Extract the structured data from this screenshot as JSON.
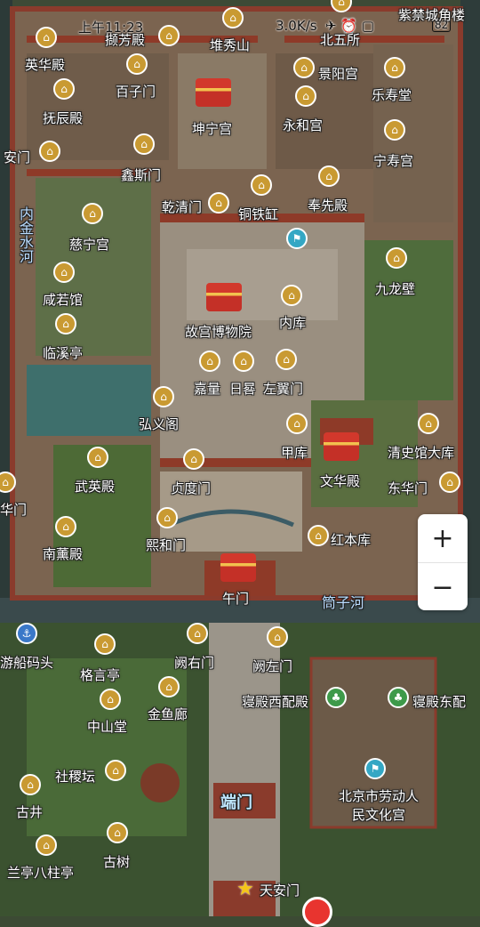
{
  "status_bar": {
    "time": "上午11:23",
    "speed": "3.0K/s",
    "icons": "✈ ⏰ ▢ ",
    "battery": "82"
  },
  "top_right_label": "紫禁城角楼",
  "zoom": {
    "in_label": "+",
    "out_label": "−"
  },
  "pois": [
    {
      "name": "英华殿",
      "icon": "gold"
    },
    {
      "name": "撷芳殿",
      "icon": "gold"
    },
    {
      "name": "堆秀山",
      "icon": "gold"
    },
    {
      "name": "北五所",
      "icon": "gold"
    },
    {
      "name": "百子门",
      "icon": "gold"
    },
    {
      "name": "景阳宫",
      "icon": "gold"
    },
    {
      "name": "乐寿堂",
      "icon": "gold"
    },
    {
      "name": "抚辰殿",
      "icon": "gold"
    },
    {
      "name": "坤宁宫",
      "icon": "palace"
    },
    {
      "name": "永和宫",
      "icon": "gold"
    },
    {
      "name": "安门",
      "icon": "gold"
    },
    {
      "name": "宁寿宫",
      "icon": "gold"
    },
    {
      "name": "鑫斯门",
      "icon": "gold"
    },
    {
      "name": "乾清门",
      "icon": "gold"
    },
    {
      "name": "铜铁缸",
      "icon": "gold"
    },
    {
      "name": "奉先殿",
      "icon": "gold"
    },
    {
      "name": "慈宁宫",
      "icon": "gold"
    },
    {
      "name": "九龙壁",
      "icon": "gold"
    },
    {
      "name": "咸若馆",
      "icon": "gold"
    },
    {
      "name": "故宫博物院",
      "icon": "palace"
    },
    {
      "name": "内库",
      "icon": "gold"
    },
    {
      "name": "临溪亭",
      "icon": "gold"
    },
    {
      "name": "嘉量",
      "icon": "gold"
    },
    {
      "name": "日晷",
      "icon": "gold"
    },
    {
      "name": "左翼门",
      "icon": "gold"
    },
    {
      "name": "弘义阁",
      "icon": "gold"
    },
    {
      "name": "甲库",
      "icon": "gold"
    },
    {
      "name": "清史馆大库",
      "icon": "gold"
    },
    {
      "name": "武英殿",
      "icon": "gold"
    },
    {
      "name": "贞度门",
      "icon": "gold"
    },
    {
      "name": "文华殿",
      "icon": "palace"
    },
    {
      "name": "东华门",
      "icon": "gold"
    },
    {
      "name": "华门",
      "icon": "gold"
    },
    {
      "name": "熙和门",
      "icon": "gold"
    },
    {
      "name": "南薰殿",
      "icon": "gold"
    },
    {
      "name": "红本库",
      "icon": "gold"
    },
    {
      "name": "午门",
      "icon": "palace"
    },
    {
      "name": "筒子河",
      "icon": "none"
    },
    {
      "name": "游船码头",
      "icon": "blue"
    },
    {
      "name": "格言亭",
      "icon": "gold"
    },
    {
      "name": "阙右门",
      "icon": "gold"
    },
    {
      "name": "阙左门",
      "icon": "gold"
    },
    {
      "name": "中山堂",
      "icon": "gold"
    },
    {
      "name": "金鱼廊",
      "icon": "gold"
    },
    {
      "name": "寝殿西配殿",
      "icon": "green"
    },
    {
      "name": "寝殿东配",
      "icon": "green"
    },
    {
      "name": "社稷坛",
      "icon": "gold"
    },
    {
      "name": "古井",
      "icon": "gold"
    },
    {
      "name": "端门",
      "icon": "none"
    },
    {
      "name": "北京市劳动人民文化宫",
      "icon": "teal"
    },
    {
      "name": "兰亭八柱亭",
      "icon": "gold"
    },
    {
      "name": "古树",
      "icon": "gold"
    },
    {
      "name": "天安门",
      "icon": "star"
    },
    {
      "name": "内金水河",
      "icon": "none"
    },
    {
      "name": "toilet",
      "icon": "teal"
    }
  ]
}
